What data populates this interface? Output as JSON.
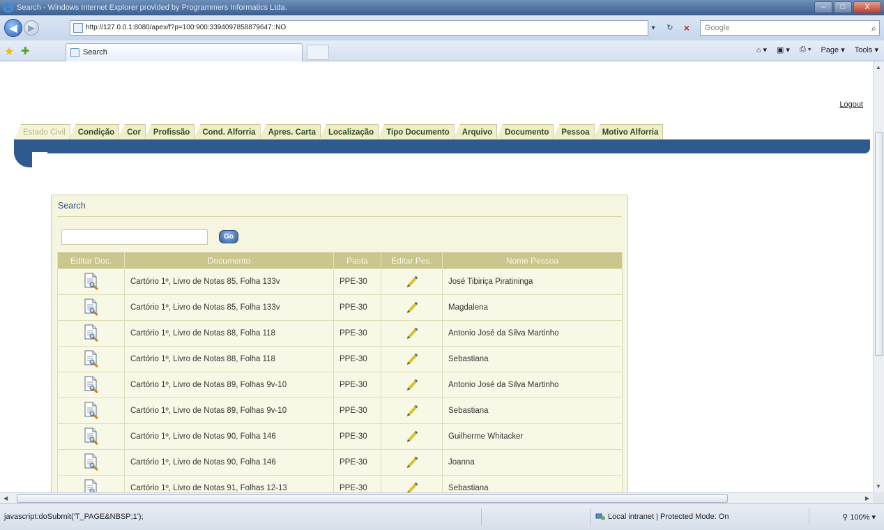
{
  "window": {
    "title": "Search - Windows Internet Explorer provided by Programmers Informatics Ltda.",
    "buttons": {
      "minimize": "–",
      "maximize": "□",
      "close": "X"
    }
  },
  "browser": {
    "back_label": "◀",
    "forward_label": "▶",
    "address": "http://127.0.0.1:8080/apex/f?p=100:900:3394097858879647::NO",
    "refresh_label": "↻",
    "stop_label": "×",
    "search_placeholder": "Google",
    "tab_title": "Search",
    "commands": {
      "page": "Page ▾",
      "tools": "Tools ▾"
    }
  },
  "page": {
    "logout": "Logout",
    "tabs": [
      {
        "label": "Estado Civil",
        "active": true
      },
      {
        "label": "Condição"
      },
      {
        "label": "Cor"
      },
      {
        "label": "Profissão"
      },
      {
        "label": "Cond. Alforria"
      },
      {
        "label": "Apres. Carta"
      },
      {
        "label": "Localização"
      },
      {
        "label": "Tipo Documento"
      },
      {
        "label": "Arquivo"
      },
      {
        "label": "Documento"
      },
      {
        "label": "Pessoa"
      },
      {
        "label": "Motivo Alforria"
      }
    ],
    "search_region": {
      "title": "Search",
      "input_value": "",
      "go_label": "Go",
      "columns": [
        "Editar Doc.",
        "Documento",
        "Pasta",
        "Editar Pes.",
        "Nome Pessoa"
      ],
      "rows": [
        {
          "documento": "Cartório 1º, Livro de Notas 85, Folha 133v",
          "pasta": "PPE-30",
          "nome": "José Tibiriça Piratininga"
        },
        {
          "documento": "Cartório 1º, Livro de Notas 85, Folha 133v",
          "pasta": "PPE-30",
          "nome": "Magdalena"
        },
        {
          "documento": "Cartório 1º, Livro de Notas 88, Folha 118",
          "pasta": "PPE-30",
          "nome": "Antonio José da Silva Martinho"
        },
        {
          "documento": "Cartório 1º, Livro de Notas 88, Folha 118",
          "pasta": "PPE-30",
          "nome": "Sebastiana"
        },
        {
          "documento": "Cartório 1º, Livro de Notas 89, Folhas 9v-10",
          "pasta": "PPE-30",
          "nome": "Antonio José da Silva Martinho"
        },
        {
          "documento": "Cartório 1º, Livro de Notas 89, Folhas 9v-10",
          "pasta": "PPE-30",
          "nome": "Sebastiana"
        },
        {
          "documento": "Cartório 1º, Livro de Notas 90, Folha 146",
          "pasta": "PPE-30",
          "nome": "Guilherme Whitacker"
        },
        {
          "documento": "Cartório 1º, Livro de Notas 90, Folha 146",
          "pasta": "PPE-30",
          "nome": "Joanna"
        },
        {
          "documento": "Cartório 1º, Livro de Notas 91, Folhas 12-13",
          "pasta": "PPE-30",
          "nome": "Sebastiana"
        }
      ]
    }
  },
  "status": {
    "text": "javascript:doSubmit('T_PAGE&NBSP;1');",
    "zone": "Local intranet | Protected Mode: On",
    "zoom": "100%"
  },
  "colors": {
    "tab_bg": "#efeecb",
    "brand_blue": "#2f5a8f",
    "table_header": "#c9c68e",
    "region_bg": "#f6f6e0"
  },
  "icons": {
    "edit_doc": "document-magnifier-icon",
    "edit_person": "pencil-icon"
  }
}
